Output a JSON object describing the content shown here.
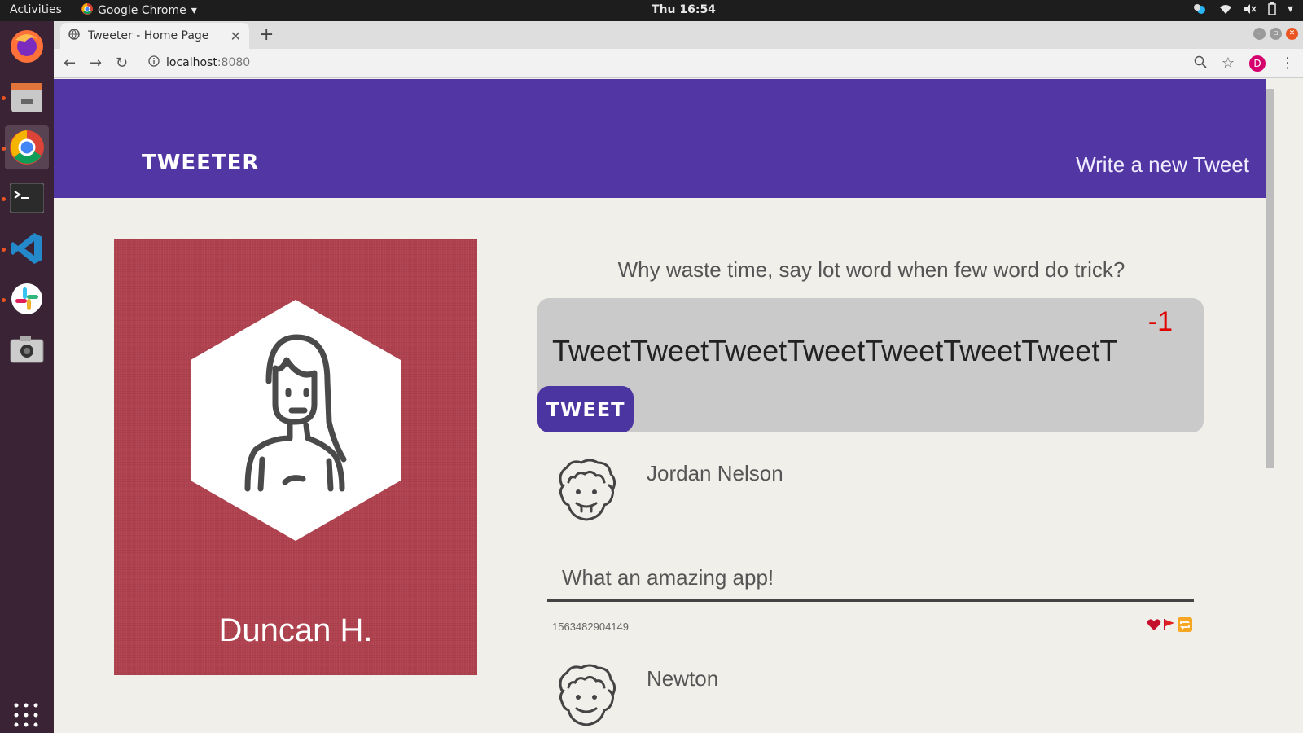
{
  "os": {
    "activities": "Activities",
    "app_menu": "Google Chrome",
    "clock": "Thu 16:54"
  },
  "browser": {
    "tab_title": "Tweeter - Home Page",
    "url_host": "localhost",
    "url_port": ":8080",
    "profile_initial": "D"
  },
  "header": {
    "brand": "TWEETER",
    "compose_link": "Write a new Tweet"
  },
  "profile": {
    "name": "Duncan H."
  },
  "composer": {
    "prompt": "Why waste time, say lot word when few word do trick?",
    "counter": "-1",
    "text": "TweetTweetTweetTweetTweetTweetTweetT",
    "button": "TWEET"
  },
  "tweets": [
    {
      "author": "Jordan Nelson",
      "body": "What an amazing app!",
      "timestamp": "1563482904149"
    },
    {
      "author": "Newton"
    }
  ],
  "colors": {
    "header": "#5136a4",
    "profile_card": "#b0414e",
    "composer_bg": "#cacaca",
    "counter": "#e00000",
    "tweet_button": "#4b35a0"
  },
  "icons": [
    "chrome-icon",
    "wifi-icon",
    "volume-icon",
    "battery-icon",
    "heart-icon",
    "flag-icon",
    "retweet-icon"
  ]
}
